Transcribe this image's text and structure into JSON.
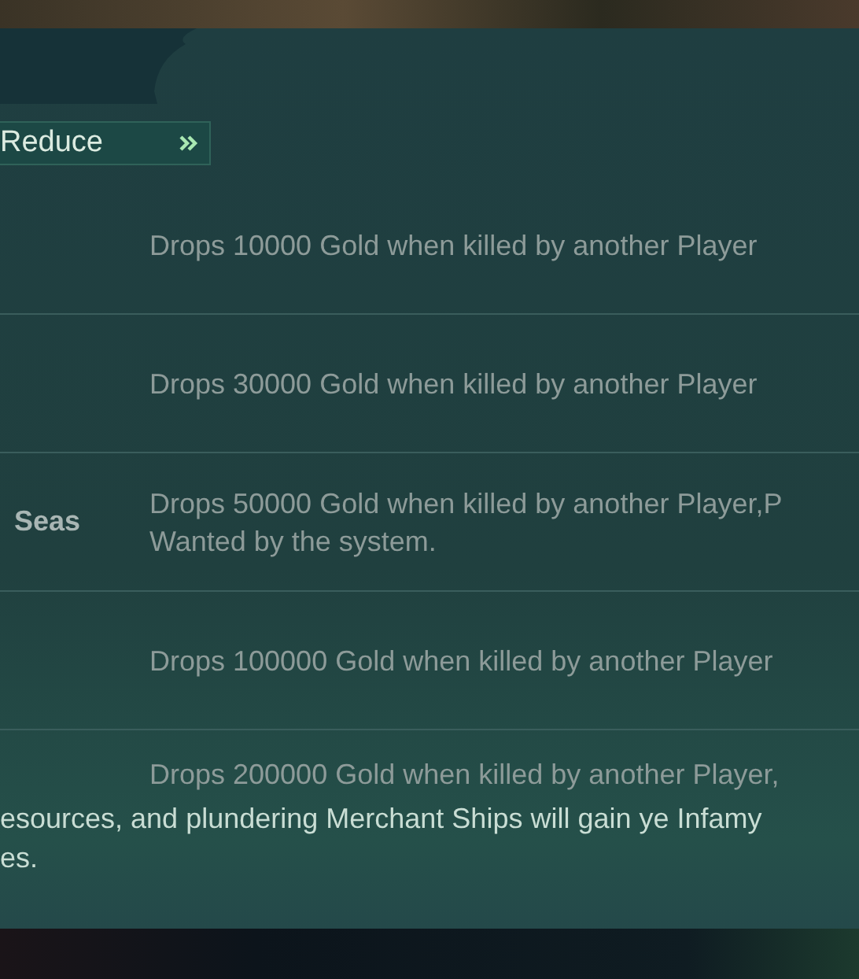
{
  "reduce_button": {
    "label": "Reduce"
  },
  "rows": [
    {
      "label": null,
      "lines": [
        "Drops 10000 Gold when killed by another Player"
      ]
    },
    {
      "label": null,
      "lines": [
        "Drops 30000 Gold when killed by another Player"
      ]
    },
    {
      "label": "Seas",
      "lines": [
        "Drops 50000 Gold when killed by another Player,P",
        "Wanted by the system."
      ]
    },
    {
      "label": null,
      "lines": [
        "Drops 100000 Gold when killed by another Player"
      ]
    },
    {
      "label": null,
      "lines": [
        "Drops 200000 Gold when killed by another Player,"
      ]
    }
  ],
  "footer": {
    "lines": [
      "esources, and plundering Merchant Ships will gain ye Infamy",
      "es."
    ]
  }
}
